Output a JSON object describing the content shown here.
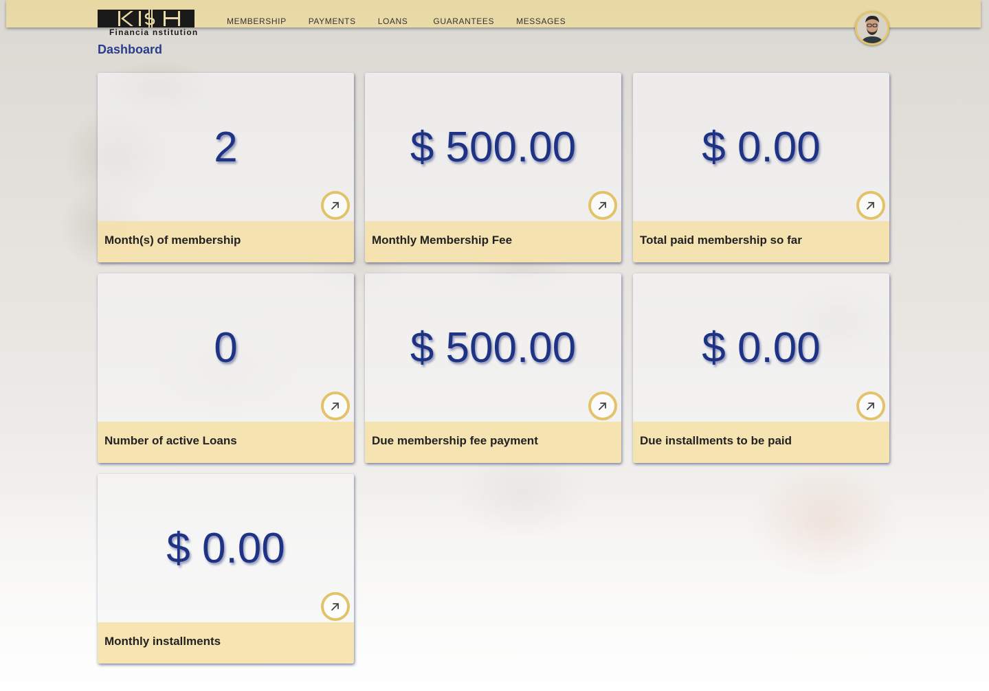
{
  "brand": {
    "name": "Financial Institution",
    "logo_text": "Financia nstitution",
    "accent_gold": "#e2c36a",
    "accent_blue": "#1f3385"
  },
  "nav": {
    "items": [
      {
        "label": "MEMBERSHIP"
      },
      {
        "label": "PAYMENTS"
      },
      {
        "label": "LOANS"
      },
      {
        "label": "GUARANTEES"
      },
      {
        "label": "MESSAGES"
      }
    ]
  },
  "user": {
    "avatar_icon": "user-avatar"
  },
  "page": {
    "title": "Dashboard"
  },
  "cards": [
    {
      "value": "2",
      "label": "Month(s) of membership",
      "icon": "arrow-up-right-icon"
    },
    {
      "value": "$ 500.00",
      "label": "Monthly Membership Fee",
      "icon": "arrow-up-right-icon"
    },
    {
      "value": "$ 0.00",
      "label": "Total paid membership so far",
      "icon": "arrow-up-right-icon"
    },
    {
      "value": "0",
      "label": "Number of active Loans",
      "icon": "arrow-up-right-icon"
    },
    {
      "value": "$ 500.00",
      "label": "Due membership fee payment",
      "icon": "arrow-up-right-icon"
    },
    {
      "value": "$ 0.00",
      "label": "Due installments to be paid",
      "icon": "arrow-up-right-icon"
    },
    {
      "value": "$ 0.00",
      "label": "Monthly installments",
      "icon": "arrow-up-right-icon"
    }
  ]
}
